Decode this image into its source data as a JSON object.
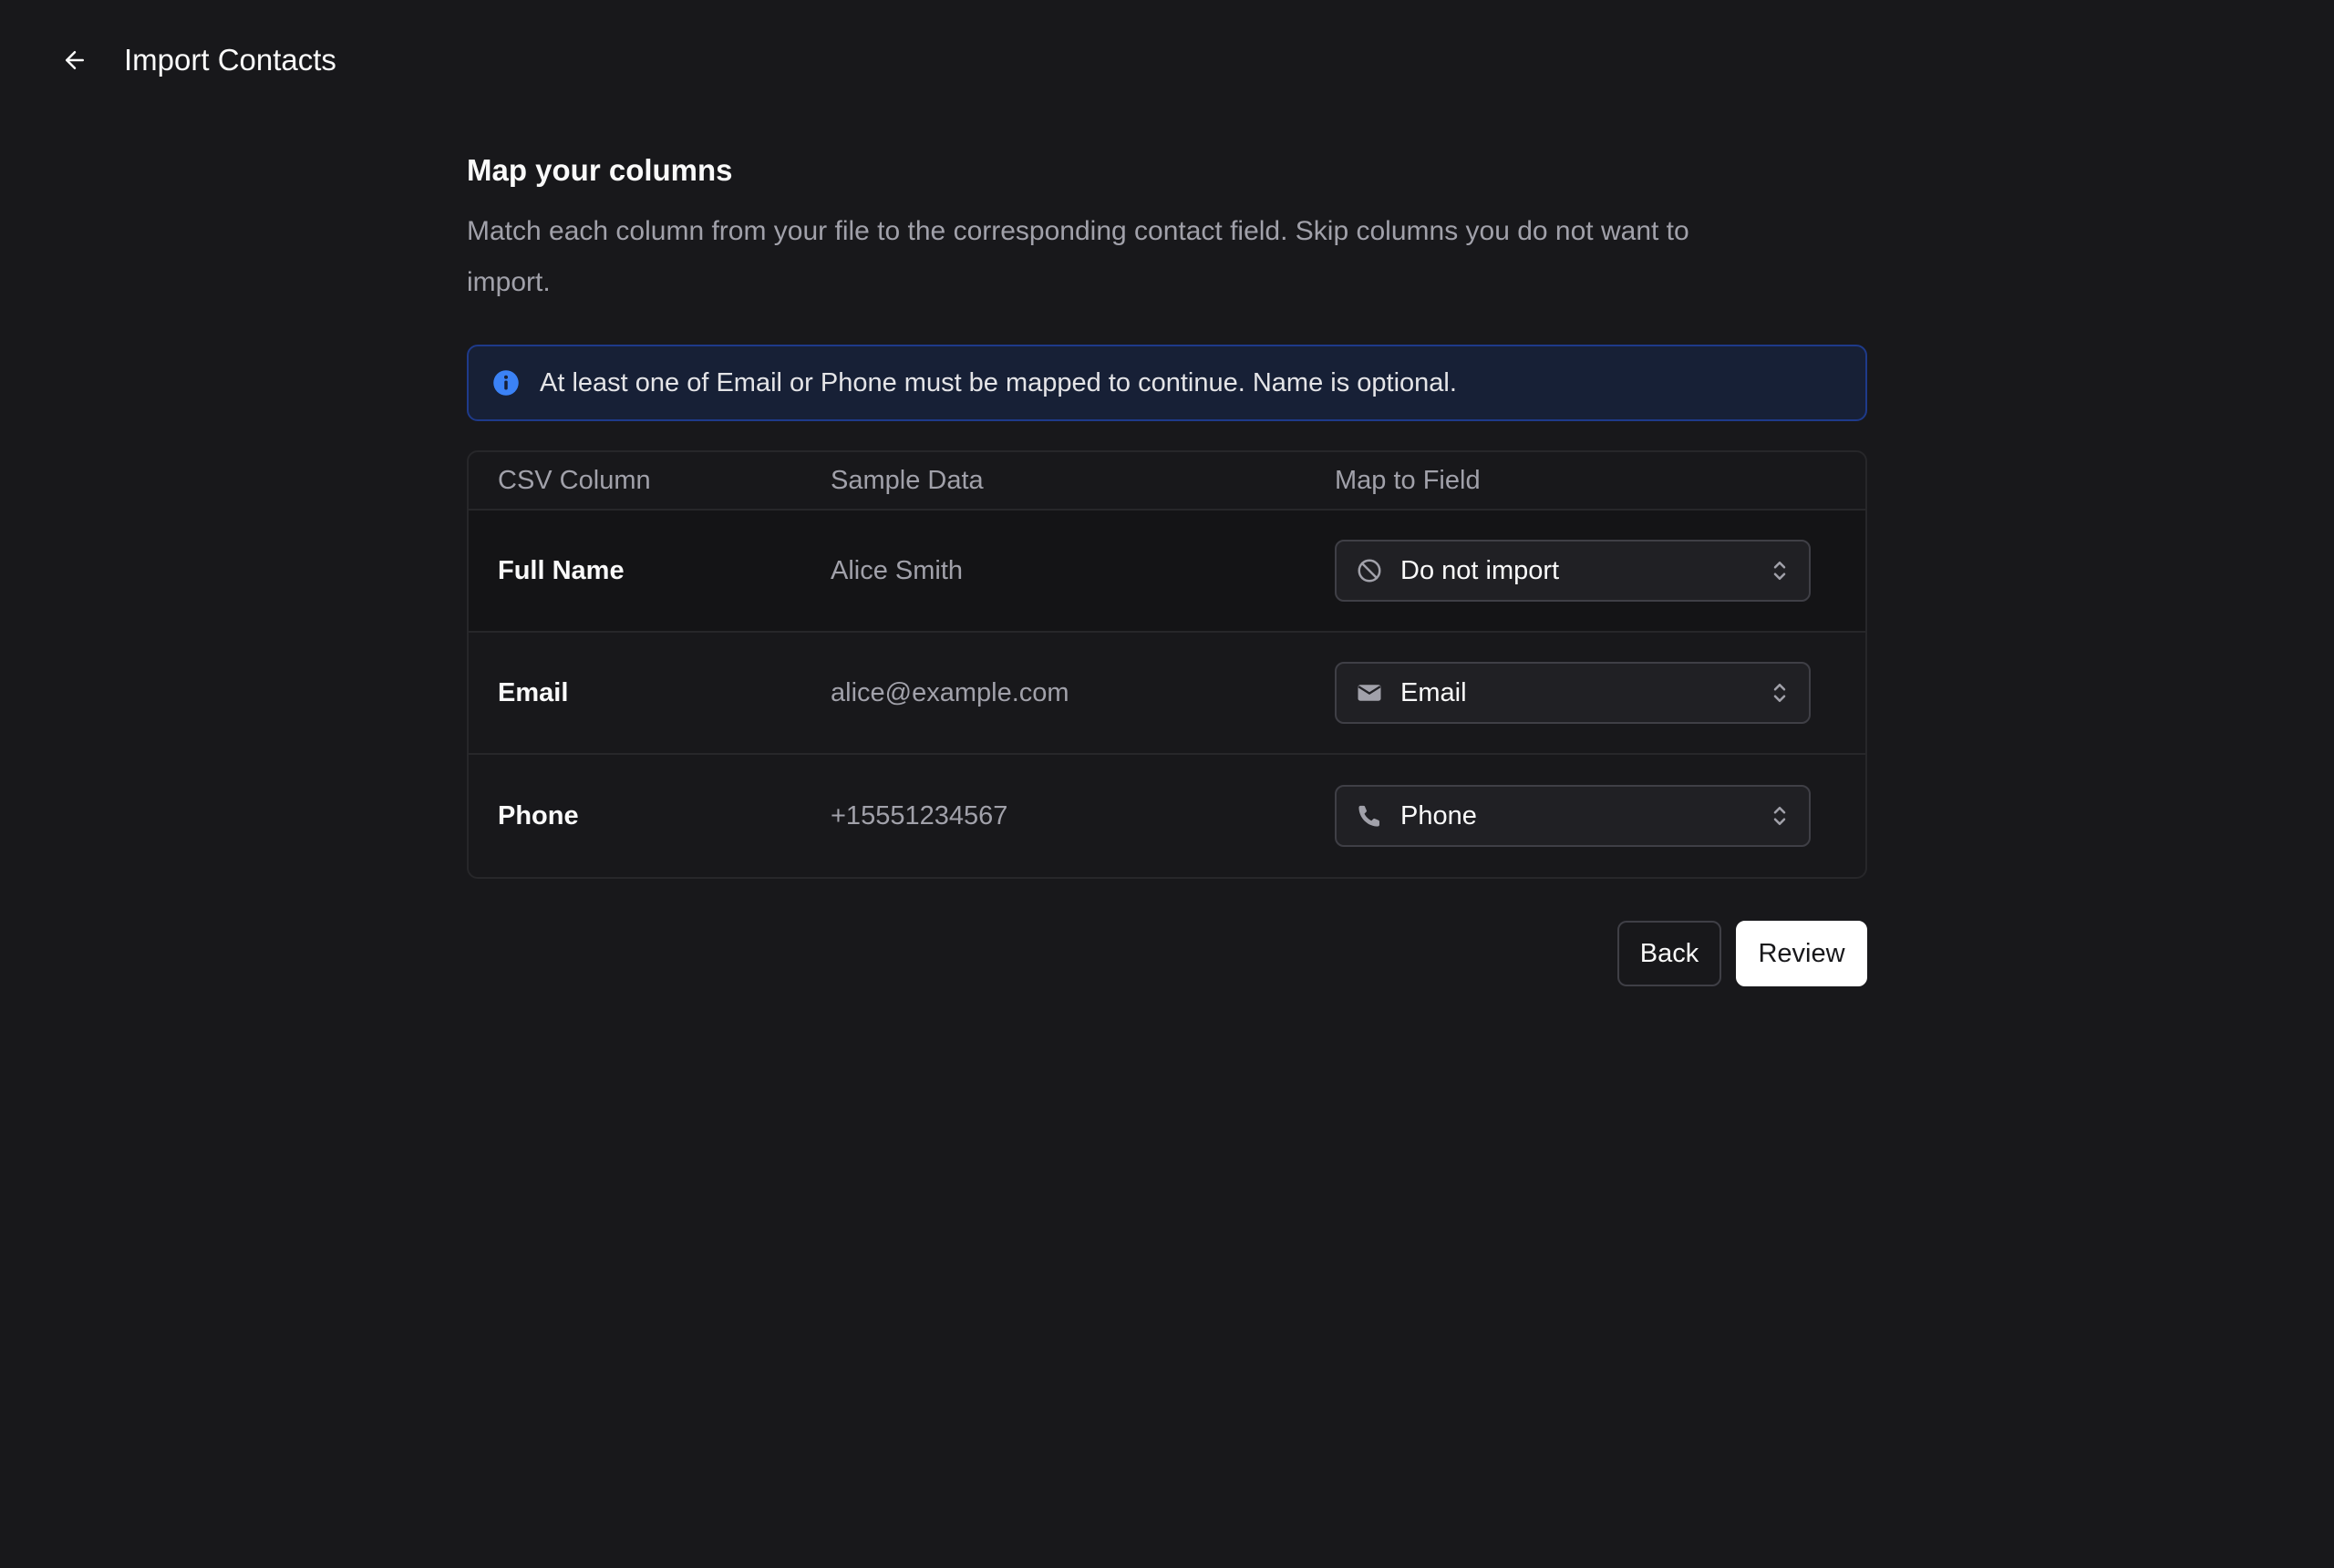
{
  "header": {
    "title": "Import Contacts",
    "back_icon": "arrow-left-icon"
  },
  "section": {
    "title": "Map your columns",
    "description": "Match each column from your file to the corresponding contact field. Skip columns you do not want to import."
  },
  "alert": {
    "icon": "info-icon",
    "text": "At least one of Email or Phone must be mapped to continue. Name is optional.",
    "accent_color": "#3b82f6"
  },
  "table": {
    "headers": [
      "CSV Column",
      "Sample Data",
      "Map to Field"
    ],
    "rows": [
      {
        "column": "Full Name",
        "sample": "Alice Smith",
        "field": "Do not import",
        "field_icon": "ban-icon"
      },
      {
        "column": "Email",
        "sample": "alice@example.com",
        "field": "Email",
        "field_icon": "envelope-icon"
      },
      {
        "column": "Phone",
        "sample": "+15551234567",
        "field": "Phone",
        "field_icon": "phone-icon"
      }
    ]
  },
  "actions": {
    "back_label": "Back",
    "review_label": "Review"
  }
}
